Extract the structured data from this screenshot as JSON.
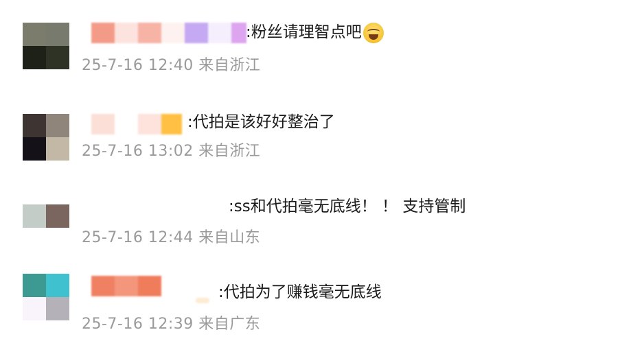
{
  "colors": {
    "text": "#1a1a1a",
    "meta": "#9a9a9a",
    "background": "#ffffff"
  },
  "comments": [
    {
      "text": ":粉丝请理智点吧",
      "emoji": "laughing-tears-icon",
      "time": "25-7-16 12:40",
      "location": "来自浙江"
    },
    {
      "text": ":代拍是该好好整治了",
      "time": "25-7-16 13:02",
      "location": "来自浙江"
    },
    {
      "text": ":ss和代拍毫无底线！ ！ 支持管制",
      "time": "25-7-16 12:44",
      "location": "来自山东"
    },
    {
      "text": ":代拍为了赚钱毫无底线",
      "time": "25-7-16 12:39",
      "location": "来自广东"
    }
  ]
}
